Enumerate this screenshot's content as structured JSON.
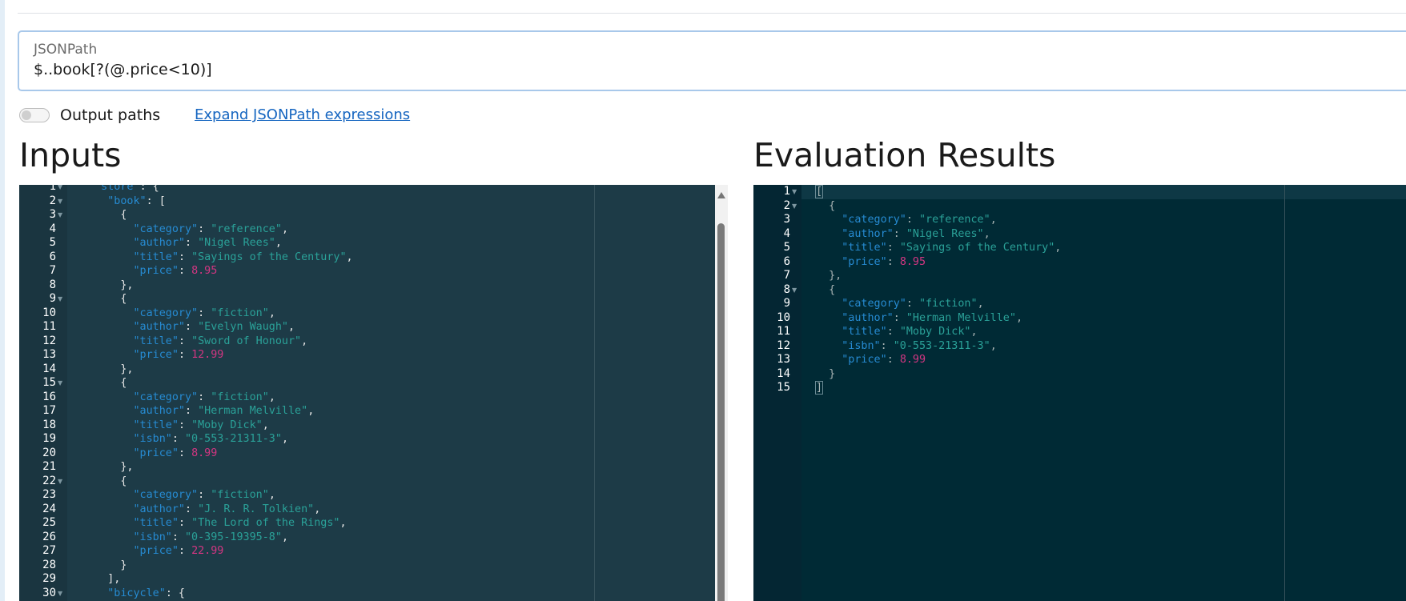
{
  "jsonpath": {
    "label": "JSONPath",
    "value": "$..book[?(@.price<10)]"
  },
  "options": {
    "output_paths_label": "Output paths",
    "output_paths_enabled": false,
    "expand_link": "Expand JSONPath expressions"
  },
  "inputs": {
    "heading": "Inputs",
    "lines": [
      {
        "n": "1",
        "fold": true,
        "tokens": [
          {
            "t": "p",
            "v": "  "
          },
          {
            "t": "k",
            "v": "\"store\""
          },
          {
            "t": "p",
            "v": ": {"
          }
        ]
      },
      {
        "n": "2",
        "fold": true,
        "tokens": [
          {
            "t": "p",
            "v": "    "
          },
          {
            "t": "k",
            "v": "\"book\""
          },
          {
            "t": "p",
            "v": ": ["
          }
        ]
      },
      {
        "n": "3",
        "fold": true,
        "tokens": [
          {
            "t": "p",
            "v": "      {"
          }
        ]
      },
      {
        "n": "4",
        "fold": false,
        "tokens": [
          {
            "t": "p",
            "v": "        "
          },
          {
            "t": "k",
            "v": "\"category\""
          },
          {
            "t": "p",
            "v": ": "
          },
          {
            "t": "s",
            "v": "\"reference\""
          },
          {
            "t": "p",
            "v": ","
          }
        ]
      },
      {
        "n": "5",
        "fold": false,
        "tokens": [
          {
            "t": "p",
            "v": "        "
          },
          {
            "t": "k",
            "v": "\"author\""
          },
          {
            "t": "p",
            "v": ": "
          },
          {
            "t": "s",
            "v": "\"Nigel Rees\""
          },
          {
            "t": "p",
            "v": ","
          }
        ]
      },
      {
        "n": "6",
        "fold": false,
        "tokens": [
          {
            "t": "p",
            "v": "        "
          },
          {
            "t": "k",
            "v": "\"title\""
          },
          {
            "t": "p",
            "v": ": "
          },
          {
            "t": "s",
            "v": "\"Sayings of the Century\""
          },
          {
            "t": "p",
            "v": ","
          }
        ]
      },
      {
        "n": "7",
        "fold": false,
        "tokens": [
          {
            "t": "p",
            "v": "        "
          },
          {
            "t": "k",
            "v": "\"price\""
          },
          {
            "t": "p",
            "v": ": "
          },
          {
            "t": "n",
            "v": "8.95"
          }
        ]
      },
      {
        "n": "8",
        "fold": false,
        "tokens": [
          {
            "t": "p",
            "v": "      },"
          }
        ]
      },
      {
        "n": "9",
        "fold": true,
        "tokens": [
          {
            "t": "p",
            "v": "      {"
          }
        ]
      },
      {
        "n": "10",
        "fold": false,
        "tokens": [
          {
            "t": "p",
            "v": "        "
          },
          {
            "t": "k",
            "v": "\"category\""
          },
          {
            "t": "p",
            "v": ": "
          },
          {
            "t": "s",
            "v": "\"fiction\""
          },
          {
            "t": "p",
            "v": ","
          }
        ]
      },
      {
        "n": "11",
        "fold": false,
        "tokens": [
          {
            "t": "p",
            "v": "        "
          },
          {
            "t": "k",
            "v": "\"author\""
          },
          {
            "t": "p",
            "v": ": "
          },
          {
            "t": "s",
            "v": "\"Evelyn Waugh\""
          },
          {
            "t": "p",
            "v": ","
          }
        ]
      },
      {
        "n": "12",
        "fold": false,
        "tokens": [
          {
            "t": "p",
            "v": "        "
          },
          {
            "t": "k",
            "v": "\"title\""
          },
          {
            "t": "p",
            "v": ": "
          },
          {
            "t": "s",
            "v": "\"Sword of Honour\""
          },
          {
            "t": "p",
            "v": ","
          }
        ]
      },
      {
        "n": "13",
        "fold": false,
        "tokens": [
          {
            "t": "p",
            "v": "        "
          },
          {
            "t": "k",
            "v": "\"price\""
          },
          {
            "t": "p",
            "v": ": "
          },
          {
            "t": "n",
            "v": "12.99"
          }
        ]
      },
      {
        "n": "14",
        "fold": false,
        "tokens": [
          {
            "t": "p",
            "v": "      },"
          }
        ]
      },
      {
        "n": "15",
        "fold": true,
        "tokens": [
          {
            "t": "p",
            "v": "      {"
          }
        ]
      },
      {
        "n": "16",
        "fold": false,
        "tokens": [
          {
            "t": "p",
            "v": "        "
          },
          {
            "t": "k",
            "v": "\"category\""
          },
          {
            "t": "p",
            "v": ": "
          },
          {
            "t": "s",
            "v": "\"fiction\""
          },
          {
            "t": "p",
            "v": ","
          }
        ]
      },
      {
        "n": "17",
        "fold": false,
        "tokens": [
          {
            "t": "p",
            "v": "        "
          },
          {
            "t": "k",
            "v": "\"author\""
          },
          {
            "t": "p",
            "v": ": "
          },
          {
            "t": "s",
            "v": "\"Herman Melville\""
          },
          {
            "t": "p",
            "v": ","
          }
        ]
      },
      {
        "n": "18",
        "fold": false,
        "tokens": [
          {
            "t": "p",
            "v": "        "
          },
          {
            "t": "k",
            "v": "\"title\""
          },
          {
            "t": "p",
            "v": ": "
          },
          {
            "t": "s",
            "v": "\"Moby Dick\""
          },
          {
            "t": "p",
            "v": ","
          }
        ]
      },
      {
        "n": "19",
        "fold": false,
        "tokens": [
          {
            "t": "p",
            "v": "        "
          },
          {
            "t": "k",
            "v": "\"isbn\""
          },
          {
            "t": "p",
            "v": ": "
          },
          {
            "t": "s",
            "v": "\"0-553-21311-3\""
          },
          {
            "t": "p",
            "v": ","
          }
        ]
      },
      {
        "n": "20",
        "fold": false,
        "tokens": [
          {
            "t": "p",
            "v": "        "
          },
          {
            "t": "k",
            "v": "\"price\""
          },
          {
            "t": "p",
            "v": ": "
          },
          {
            "t": "n",
            "v": "8.99"
          }
        ]
      },
      {
        "n": "21",
        "fold": false,
        "tokens": [
          {
            "t": "p",
            "v": "      },"
          }
        ]
      },
      {
        "n": "22",
        "fold": true,
        "tokens": [
          {
            "t": "p",
            "v": "      {"
          }
        ]
      },
      {
        "n": "23",
        "fold": false,
        "tokens": [
          {
            "t": "p",
            "v": "        "
          },
          {
            "t": "k",
            "v": "\"category\""
          },
          {
            "t": "p",
            "v": ": "
          },
          {
            "t": "s",
            "v": "\"fiction\""
          },
          {
            "t": "p",
            "v": ","
          }
        ]
      },
      {
        "n": "24",
        "fold": false,
        "tokens": [
          {
            "t": "p",
            "v": "        "
          },
          {
            "t": "k",
            "v": "\"author\""
          },
          {
            "t": "p",
            "v": ": "
          },
          {
            "t": "s",
            "v": "\"J. R. R. Tolkien\""
          },
          {
            "t": "p",
            "v": ","
          }
        ]
      },
      {
        "n": "25",
        "fold": false,
        "tokens": [
          {
            "t": "p",
            "v": "        "
          },
          {
            "t": "k",
            "v": "\"title\""
          },
          {
            "t": "p",
            "v": ": "
          },
          {
            "t": "s",
            "v": "\"The Lord of the Rings\""
          },
          {
            "t": "p",
            "v": ","
          }
        ]
      },
      {
        "n": "26",
        "fold": false,
        "tokens": [
          {
            "t": "p",
            "v": "        "
          },
          {
            "t": "k",
            "v": "\"isbn\""
          },
          {
            "t": "p",
            "v": ": "
          },
          {
            "t": "s",
            "v": "\"0-395-19395-8\""
          },
          {
            "t": "p",
            "v": ","
          }
        ]
      },
      {
        "n": "27",
        "fold": false,
        "tokens": [
          {
            "t": "p",
            "v": "        "
          },
          {
            "t": "k",
            "v": "\"price\""
          },
          {
            "t": "p",
            "v": ": "
          },
          {
            "t": "n",
            "v": "22.99"
          }
        ]
      },
      {
        "n": "28",
        "fold": false,
        "tokens": [
          {
            "t": "p",
            "v": "      }"
          }
        ]
      },
      {
        "n": "29",
        "fold": false,
        "tokens": [
          {
            "t": "p",
            "v": "    ],"
          }
        ]
      },
      {
        "n": "30",
        "fold": true,
        "tokens": [
          {
            "t": "p",
            "v": "    "
          },
          {
            "t": "k",
            "v": "\"bicycle\""
          },
          {
            "t": "p",
            "v": ": {"
          }
        ]
      }
    ]
  },
  "results": {
    "heading": "Evaluation Results",
    "lines": [
      {
        "n": "1",
        "fold": true,
        "tokens": [
          {
            "t": "c",
            "v": "["
          }
        ]
      },
      {
        "n": "2",
        "fold": true,
        "tokens": [
          {
            "t": "p",
            "v": "  {"
          }
        ]
      },
      {
        "n": "3",
        "fold": false,
        "tokens": [
          {
            "t": "p",
            "v": "    "
          },
          {
            "t": "k",
            "v": "\"category\""
          },
          {
            "t": "p",
            "v": ": "
          },
          {
            "t": "s",
            "v": "\"reference\""
          },
          {
            "t": "p",
            "v": ","
          }
        ]
      },
      {
        "n": "4",
        "fold": false,
        "tokens": [
          {
            "t": "p",
            "v": "    "
          },
          {
            "t": "k",
            "v": "\"author\""
          },
          {
            "t": "p",
            "v": ": "
          },
          {
            "t": "s",
            "v": "\"Nigel Rees\""
          },
          {
            "t": "p",
            "v": ","
          }
        ]
      },
      {
        "n": "5",
        "fold": false,
        "tokens": [
          {
            "t": "p",
            "v": "    "
          },
          {
            "t": "k",
            "v": "\"title\""
          },
          {
            "t": "p",
            "v": ": "
          },
          {
            "t": "s",
            "v": "\"Sayings of the Century\""
          },
          {
            "t": "p",
            "v": ","
          }
        ]
      },
      {
        "n": "6",
        "fold": false,
        "tokens": [
          {
            "t": "p",
            "v": "    "
          },
          {
            "t": "k",
            "v": "\"price\""
          },
          {
            "t": "p",
            "v": ": "
          },
          {
            "t": "n",
            "v": "8.95"
          }
        ]
      },
      {
        "n": "7",
        "fold": false,
        "tokens": [
          {
            "t": "p",
            "v": "  },"
          }
        ]
      },
      {
        "n": "8",
        "fold": true,
        "tokens": [
          {
            "t": "p",
            "v": "  {"
          }
        ]
      },
      {
        "n": "9",
        "fold": false,
        "tokens": [
          {
            "t": "p",
            "v": "    "
          },
          {
            "t": "k",
            "v": "\"category\""
          },
          {
            "t": "p",
            "v": ": "
          },
          {
            "t": "s",
            "v": "\"fiction\""
          },
          {
            "t": "p",
            "v": ","
          }
        ]
      },
      {
        "n": "10",
        "fold": false,
        "tokens": [
          {
            "t": "p",
            "v": "    "
          },
          {
            "t": "k",
            "v": "\"author\""
          },
          {
            "t": "p",
            "v": ": "
          },
          {
            "t": "s",
            "v": "\"Herman Melville\""
          },
          {
            "t": "p",
            "v": ","
          }
        ]
      },
      {
        "n": "11",
        "fold": false,
        "tokens": [
          {
            "t": "p",
            "v": "    "
          },
          {
            "t": "k",
            "v": "\"title\""
          },
          {
            "t": "p",
            "v": ": "
          },
          {
            "t": "s",
            "v": "\"Moby Dick\""
          },
          {
            "t": "p",
            "v": ","
          }
        ]
      },
      {
        "n": "12",
        "fold": false,
        "tokens": [
          {
            "t": "p",
            "v": "    "
          },
          {
            "t": "k",
            "v": "\"isbn\""
          },
          {
            "t": "p",
            "v": ": "
          },
          {
            "t": "s",
            "v": "\"0-553-21311-3\""
          },
          {
            "t": "p",
            "v": ","
          }
        ]
      },
      {
        "n": "13",
        "fold": false,
        "tokens": [
          {
            "t": "p",
            "v": "    "
          },
          {
            "t": "k",
            "v": "\"price\""
          },
          {
            "t": "p",
            "v": ": "
          },
          {
            "t": "n",
            "v": "8.99"
          }
        ]
      },
      {
        "n": "14",
        "fold": false,
        "tokens": [
          {
            "t": "p",
            "v": "  }"
          }
        ]
      },
      {
        "n": "15",
        "fold": false,
        "tokens": [
          {
            "t": "c",
            "v": "]"
          }
        ]
      }
    ]
  },
  "colors": {
    "key": "#268bd2",
    "string": "#2aa198",
    "number": "#d33682",
    "link": "#1565c0",
    "input_bg": "#1d3b47",
    "result_bg": "#002a35"
  },
  "icons": {
    "fold": "fold-arrow-icon",
    "scroll_up": "scroll-up-arrow-icon"
  }
}
